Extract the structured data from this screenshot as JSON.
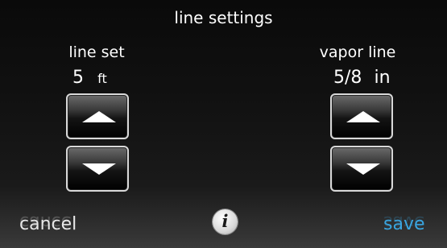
{
  "header": {
    "title": "line settings"
  },
  "line_set": {
    "label": "line set",
    "value": "5",
    "unit": "ft"
  },
  "vapor_line": {
    "label": "vapor line",
    "value": "5/8",
    "unit": "in"
  },
  "footer": {
    "cancel_label": "cancel",
    "info_glyph": "i",
    "save_label": "save"
  },
  "colors": {
    "save_accent": "#3aa5e0",
    "background": "#111111"
  },
  "icons": {
    "up": "up-arrow-icon",
    "down": "down-arrow-icon",
    "info": "info-icon"
  }
}
